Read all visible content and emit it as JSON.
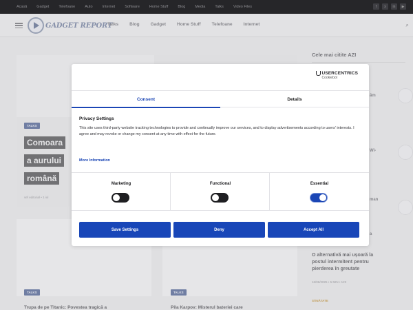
{
  "topbar": {
    "links": [
      "Acasă",
      "Gadget",
      "Telefoane",
      "Auto",
      "Internet",
      "Software",
      "Home Stuff",
      "Blog",
      "Media",
      "Talks",
      "Video Files"
    ],
    "socials": [
      "f",
      "x",
      "in",
      "▶"
    ]
  },
  "header": {
    "logo_text": "GADGET REPORT",
    "nav": [
      "Talks",
      "Blog",
      "Gadget",
      "Home Stuff",
      "Telefoane",
      "Internet"
    ]
  },
  "background": {
    "hero_tag": "TALKS",
    "hero_title_lines": [
      "Comoara",
      "a aurului",
      "română"
    ],
    "hero_meta": "sef editorial  •  1 iul",
    "card1_tag": "TALKS",
    "card1_title": "Trupa de pe Titanic: Povestea tragică a",
    "card2_tag": "TALKS",
    "card2_title": "Pila Karpov: Misterul bateriei care"
  },
  "sidebar": {
    "title": "Cele mai citite AZI",
    "snippets": [
      "ăm",
      "Wi-",
      "man",
      "a"
    ],
    "item_title": "O alternativă mai ușoară la postul intermitent pentru pierderea în greutate",
    "item_meta": "16/06/2025   •   5 MIN   •   123",
    "item_category": "SĂNĂTATE"
  },
  "dialog": {
    "brand_name": "USERCENTRICS",
    "brand_sub": "Cookiebot",
    "tabs": {
      "consent": "Consent",
      "details": "Details"
    },
    "title": "Privacy Settings",
    "body": "This site uses third-party website tracking technologies to provide and continually improve our services, and to display advertisements according to users' interests. I agree and may revoke or change my consent at any time with effect for the future.",
    "more_info": "More Information",
    "categories": [
      {
        "label": "Marketing",
        "enabled": false
      },
      {
        "label": "Functional",
        "enabled": false
      },
      {
        "label": "Essential",
        "enabled": true
      }
    ],
    "buttons": {
      "save": "Save Settings",
      "deny": "Deny",
      "accept": "Accept All"
    },
    "accent_color": "#1846b8"
  }
}
